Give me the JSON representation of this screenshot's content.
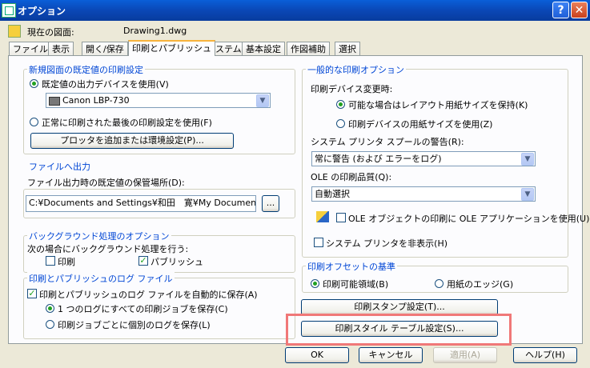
{
  "window": {
    "title": "オプション",
    "help_btn": "?",
    "close_btn": "✕"
  },
  "header": {
    "current_label": "現在の図面:",
    "current_value": "Drawing1.dwg"
  },
  "tabs": [
    "ファイル",
    "表示",
    "開く/保存",
    "印刷とパブリッシュ",
    "システム",
    "基本設定",
    "作図補助",
    "選択"
  ],
  "new_default": {
    "title": "新規図面の既定値の印刷設定",
    "use_default_device": "既定値の出力デバイスを使用(V)",
    "device_value": "Canon LBP-730",
    "use_last": "正常に印刷された最後の印刷設定を使用(F)",
    "add_config_btn": "プロッタを追加または環境設定(P)..."
  },
  "file_output": {
    "title": "ファイルへ出力",
    "location_label": "ファイル出力時の既定値の保管場所(D):",
    "path": "C:¥Documents and Settings¥和田　寛¥My Documents",
    "browse_btn": "..."
  },
  "background": {
    "title": "バックグラウンド処理のオプション",
    "desc": "次の場合にバックグラウンド処理を行う:",
    "print": "印刷",
    "publish": "パブリッシュ",
    "print_checked": false,
    "publish_checked": true
  },
  "log": {
    "title": "印刷とパブリッシュのログ ファイル",
    "autosave": "印刷とパブリッシュのログ ファイルを自動的に保存(A)",
    "one_log": "1 つのログにすべての印刷ジョブを保存(C)",
    "separate_log": "印刷ジョブごとに個別のログを保存(L)"
  },
  "general": {
    "title": "一般的な印刷オプション",
    "device_change_label": "印刷デバイス変更時:",
    "keep_layout": "可能な場合はレイアウト用紙サイズを保持(K)",
    "use_device_size": "印刷デバイスの用紙サイズを使用(Z)",
    "spool_label": "システム プリンタ スプールの警告(R):",
    "spool_value": "常に警告 (および エラーをログ)",
    "ole_quality_label": "OLE の印刷品質(Q):",
    "ole_quality_value": "自動選択",
    "ole_use_app": "OLE オブジェクトの印刷に OLE アプリケーションを使用(U)",
    "hide_system_printers": "システム プリンタを非表示(H)"
  },
  "offset": {
    "title": "印刷オフセットの基準",
    "printable_area": "印刷可能領域(B)",
    "paper_edge": "用紙のエッジ(G)"
  },
  "buttons": {
    "stamp": "印刷スタンプ設定(T)...",
    "style_table": "印刷スタイル テーブル設定(S)...",
    "ok": "OK",
    "cancel": "キャンセル",
    "apply": "適用(A)",
    "help": "ヘルプ(H)"
  },
  "colors": {
    "accent": "#0046d5",
    "titlebar": "#0a47b6",
    "highlight": "#f07878"
  }
}
